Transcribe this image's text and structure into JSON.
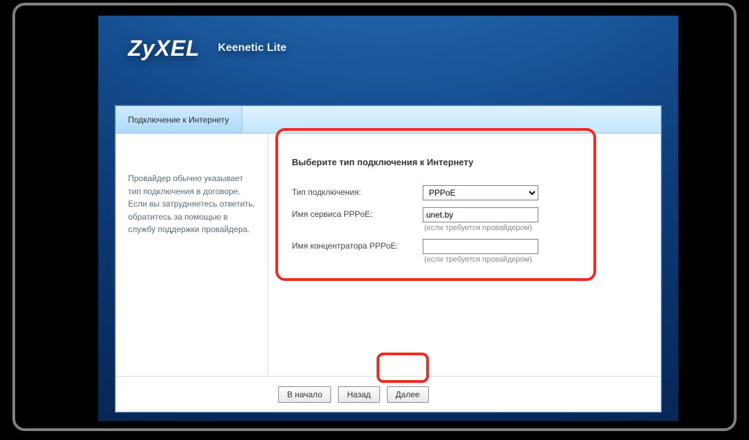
{
  "brand": "ZyXEL",
  "model": "Keenetic Lite",
  "tab": {
    "label": "Подключение к Интернету"
  },
  "sidebar_help": "Провайдер обычно указывает тип подключения в договоре. Если вы затрудняетесь ответить, обратитесь за помощью в службу поддержки провайдера.",
  "section_title": "Выберите тип подключения к Интернету",
  "fields": {
    "conn_type": {
      "label": "Тип подключения:",
      "value": "PPPoE",
      "options": [
        "PPPoE"
      ]
    },
    "service_name": {
      "label": "Имя сервиса PPPoE:",
      "value": "unet.by",
      "hint": "(если требуется провайдером)"
    },
    "concentrator": {
      "label": "Имя концентратора PPPoE:",
      "value": "",
      "hint": "(если требуется провайдером)"
    }
  },
  "buttons": {
    "home": "В начало",
    "back": "Назад",
    "next": "Далее"
  }
}
